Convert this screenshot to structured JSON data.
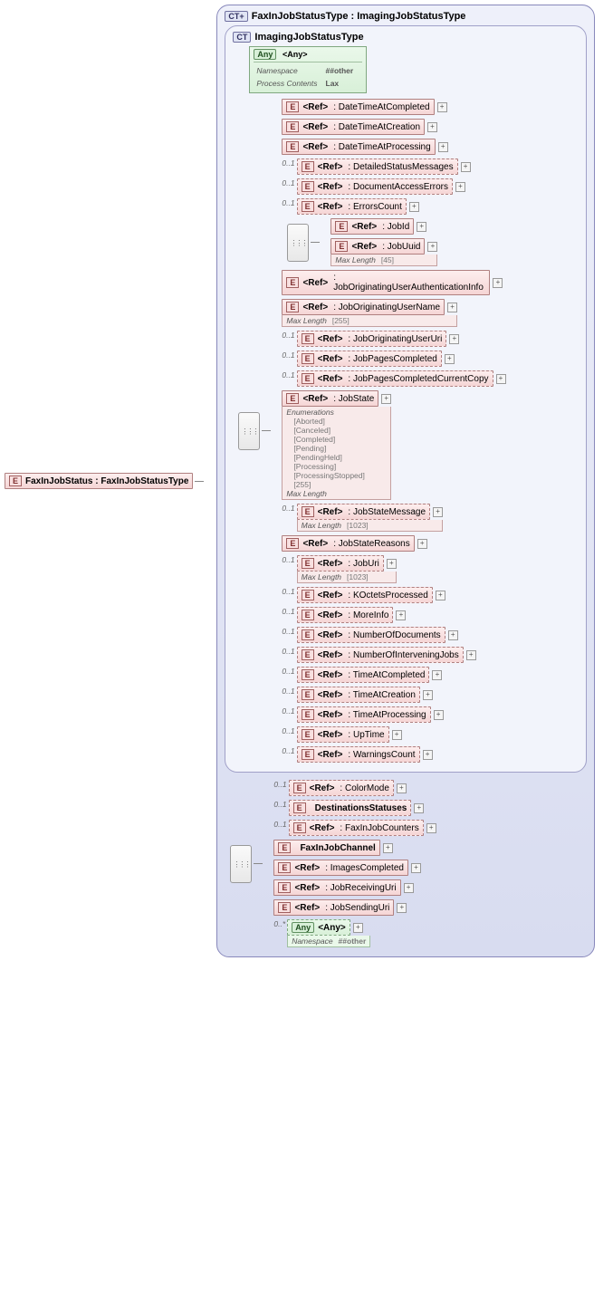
{
  "root": {
    "name": "FaxInJobStatus : FaxInJobStatusType"
  },
  "outerCT": {
    "title": "FaxInJobStatusType : ImagingJobStatusType",
    "badge": "CT+"
  },
  "innerCT": {
    "title": "ImagingJobStatusType",
    "badge": "CT"
  },
  "anyBlock": {
    "title": "<Any>",
    "namespaceLabel": "Namespace",
    "namespaceVal": "##other",
    "processLabel": "Process Contents",
    "processVal": "Lax"
  },
  "badges": {
    "E": "E",
    "Any": "Any"
  },
  "occ": {
    "opt": "0..1",
    "many": "0..*"
  },
  "refLabel": "<Ref>",
  "facetLabels": {
    "maxLength": "Max Length",
    "enums": "Enumerations"
  },
  "imaging": [
    {
      "k": "dtc",
      "name": "DateTimeAtCompleted",
      "opt": false,
      "plus": true
    },
    {
      "k": "dtcr",
      "name": "DateTimeAtCreation",
      "opt": false,
      "plus": true
    },
    {
      "k": "dtp",
      "name": "DateTimeAtProcessing",
      "opt": false,
      "plus": true
    },
    {
      "k": "dsm",
      "name": "DetailedStatusMessages",
      "opt": true,
      "plus": true
    },
    {
      "k": "dae",
      "name": "DocumentAccessErrors",
      "opt": true,
      "plus": true
    },
    {
      "k": "ec",
      "name": "ErrorsCount",
      "opt": true,
      "plus": true
    },
    {
      "k": "jobidgroup",
      "group": true,
      "children": [
        {
          "k": "jid",
          "name": "JobId",
          "plus": true
        },
        {
          "k": "juu",
          "name": "JobUuid",
          "plus": true,
          "facets": {
            "maxLength": "[45]"
          }
        }
      ]
    },
    {
      "k": "joua",
      "name": "JobOriginatingUserAuthenticationInfo",
      "opt": false,
      "plus": true,
      "long": true
    },
    {
      "k": "joun",
      "name": "JobOriginatingUserName",
      "opt": false,
      "plus": true,
      "facets": {
        "maxLength": "[255]"
      }
    },
    {
      "k": "jouu",
      "name": "JobOriginatingUserUri",
      "opt": true,
      "plus": true
    },
    {
      "k": "jpc",
      "name": "JobPagesCompleted",
      "opt": true,
      "plus": true
    },
    {
      "k": "jpcc",
      "name": "JobPagesCompletedCurrentCopy",
      "opt": true,
      "plus": true
    },
    {
      "k": "jst",
      "name": "JobState",
      "opt": false,
      "plus": true,
      "facets": {
        "enums": [
          "[Aborted]",
          "[Canceled]",
          "[Completed]",
          "[Pending]",
          "[PendingHeld]",
          "[Processing]",
          "[ProcessingStopped]",
          "[255]"
        ],
        "maxLength": ""
      }
    },
    {
      "k": "jsm",
      "name": "JobStateMessage",
      "opt": true,
      "plus": true,
      "facets": {
        "maxLength": "[1023]"
      }
    },
    {
      "k": "jsr",
      "name": "JobStateReasons",
      "opt": false,
      "plus": true
    },
    {
      "k": "jur",
      "name": "JobUri",
      "opt": true,
      "plus": true,
      "facets": {
        "maxLength": "[1023]"
      }
    },
    {
      "k": "kop",
      "name": "KOctetsProcessed",
      "opt": true,
      "plus": true
    },
    {
      "k": "mi",
      "name": "MoreInfo",
      "opt": true,
      "plus": true
    },
    {
      "k": "nod",
      "name": "NumberOfDocuments",
      "opt": true,
      "plus": true
    },
    {
      "k": "nij",
      "name": "NumberOfInterveningJobs",
      "opt": true,
      "plus": true
    },
    {
      "k": "tac",
      "name": "TimeAtCompleted",
      "opt": true,
      "plus": true
    },
    {
      "k": "tcr",
      "name": "TimeAtCreation",
      "opt": true,
      "plus": true
    },
    {
      "k": "tap",
      "name": "TimeAtProcessing",
      "opt": true,
      "plus": true
    },
    {
      "k": "upt",
      "name": "UpTime",
      "opt": true,
      "plus": true
    },
    {
      "k": "wc",
      "name": "WarningsCount",
      "opt": true,
      "plus": true
    }
  ],
  "faxExt": [
    {
      "k": "cm",
      "ref": true,
      "name": "ColorMode",
      "opt": true,
      "plus": true
    },
    {
      "k": "ds",
      "ref": false,
      "name": "DestinationsStatuses",
      "opt": true,
      "plus": true
    },
    {
      "k": "fjc",
      "ref": true,
      "name": "FaxInJobCounters",
      "opt": true,
      "plus": true
    },
    {
      "k": "fch",
      "ref": false,
      "name": "FaxInJobChannel",
      "opt": false,
      "plus": true
    },
    {
      "k": "ic",
      "ref": true,
      "name": "ImagesCompleted",
      "opt": false,
      "plus": true
    },
    {
      "k": "jru",
      "ref": true,
      "name": "JobReceivingUri",
      "opt": false,
      "plus": true
    },
    {
      "k": "jsu",
      "ref": true,
      "name": "JobSendingUri",
      "opt": false,
      "plus": true
    }
  ],
  "bottomAny": {
    "title": "<Any>",
    "namespaceLabel": "Namespace",
    "namespaceVal": "##other"
  }
}
